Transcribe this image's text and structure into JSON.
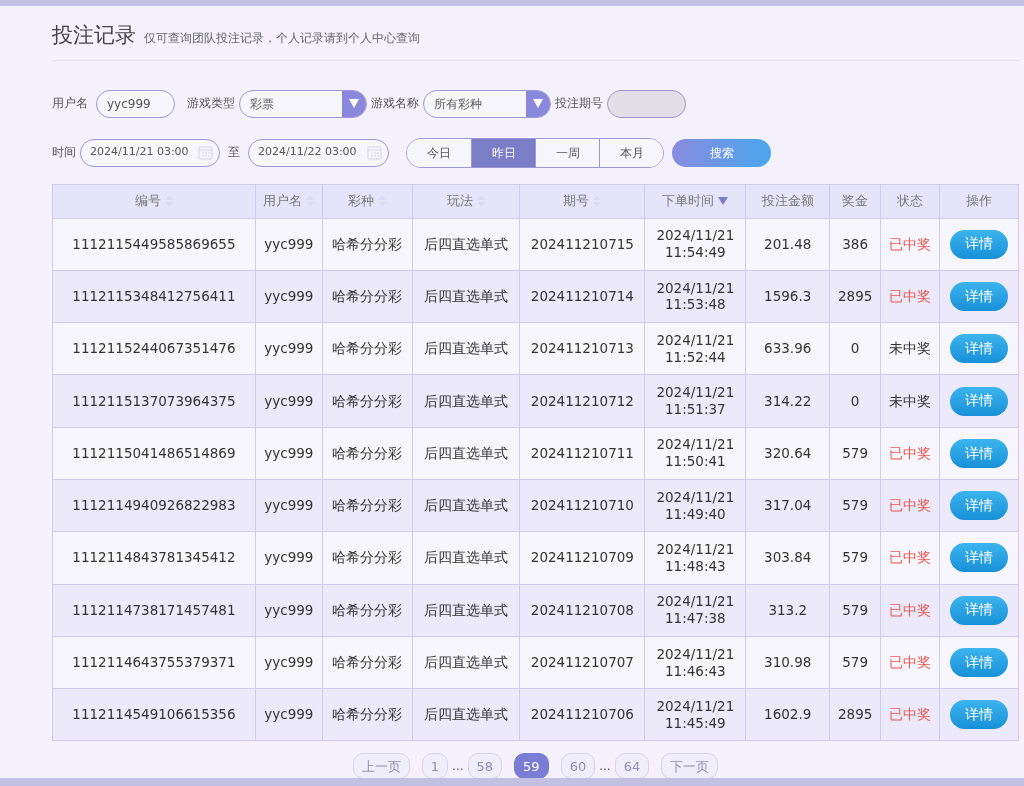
{
  "header": {
    "title": "投注记录",
    "subtitle": "仅可查询团队投注记录，个人记录请到个人中心查询"
  },
  "filters": {
    "username_label": "用户名",
    "username": "yyc999",
    "game_type_label": "游戏类型",
    "game_type": "彩票",
    "game_name_label": "游戏名称",
    "game_name": "所有彩种",
    "issue_label": "投注期号",
    "time_label": "时间",
    "time_from": "2024/11/21 03:00",
    "time_to_label": "至",
    "time_to": "2024/11/22 03:00",
    "ranges": [
      {
        "label": "今日",
        "selected": false
      },
      {
        "label": "昨日",
        "selected": true
      },
      {
        "label": "一周",
        "selected": false
      },
      {
        "label": "本月",
        "selected": false
      }
    ],
    "search_button": "搜索"
  },
  "table": {
    "columns": [
      {
        "label": "编号",
        "sortable": true,
        "sorted": false
      },
      {
        "label": "用户名",
        "sortable": true,
        "sorted": false
      },
      {
        "label": "彩种",
        "sortable": true,
        "sorted": false
      },
      {
        "label": "玩法",
        "sortable": true,
        "sorted": false
      },
      {
        "label": "期号",
        "sortable": true,
        "sorted": false
      },
      {
        "label": "下单时间",
        "sortable": true,
        "sorted": true
      },
      {
        "label": "投注金额",
        "sortable": false,
        "sorted": false
      },
      {
        "label": "奖金",
        "sortable": false,
        "sorted": false
      },
      {
        "label": "状态",
        "sortable": false,
        "sorted": false
      },
      {
        "label": "操作",
        "sortable": false,
        "sorted": false
      }
    ],
    "rows": [
      {
        "id": "1112115449585869655",
        "user": "yyc999",
        "lottery": "哈希分分彩",
        "play": "后四直选单式",
        "issue": "202411210715",
        "date": "2024/11/21",
        "time": "11:54:49",
        "amount": "201.48",
        "prize": "386",
        "status": "已中奖",
        "won": true,
        "action": "详情"
      },
      {
        "id": "1112115348412756411",
        "user": "yyc999",
        "lottery": "哈希分分彩",
        "play": "后四直选单式",
        "issue": "202411210714",
        "date": "2024/11/21",
        "time": "11:53:48",
        "amount": "1596.3",
        "prize": "2895",
        "status": "已中奖",
        "won": true,
        "action": "详情"
      },
      {
        "id": "1112115244067351476",
        "user": "yyc999",
        "lottery": "哈希分分彩",
        "play": "后四直选单式",
        "issue": "202411210713",
        "date": "2024/11/21",
        "time": "11:52:44",
        "amount": "633.96",
        "prize": "0",
        "status": "未中奖",
        "won": false,
        "action": "详情"
      },
      {
        "id": "1112115137073964375",
        "user": "yyc999",
        "lottery": "哈希分分彩",
        "play": "后四直选单式",
        "issue": "202411210712",
        "date": "2024/11/21",
        "time": "11:51:37",
        "amount": "314.22",
        "prize": "0",
        "status": "未中奖",
        "won": false,
        "action": "详情"
      },
      {
        "id": "1112115041486514869",
        "user": "yyc999",
        "lottery": "哈希分分彩",
        "play": "后四直选单式",
        "issue": "202411210711",
        "date": "2024/11/21",
        "time": "11:50:41",
        "amount": "320.64",
        "prize": "579",
        "status": "已中奖",
        "won": true,
        "action": "详情"
      },
      {
        "id": "1112114940926822983",
        "user": "yyc999",
        "lottery": "哈希分分彩",
        "play": "后四直选单式",
        "issue": "202411210710",
        "date": "2024/11/21",
        "time": "11:49:40",
        "amount": "317.04",
        "prize": "579",
        "status": "已中奖",
        "won": true,
        "action": "详情"
      },
      {
        "id": "1112114843781345412",
        "user": "yyc999",
        "lottery": "哈希分分彩",
        "play": "后四直选单式",
        "issue": "202411210709",
        "date": "2024/11/21",
        "time": "11:48:43",
        "amount": "303.84",
        "prize": "579",
        "status": "已中奖",
        "won": true,
        "action": "详情"
      },
      {
        "id": "1112114738171457481",
        "user": "yyc999",
        "lottery": "哈希分分彩",
        "play": "后四直选单式",
        "issue": "202411210708",
        "date": "2024/11/21",
        "time": "11:47:38",
        "amount": "313.2",
        "prize": "579",
        "status": "已中奖",
        "won": true,
        "action": "详情"
      },
      {
        "id": "1112114643755379371",
        "user": "yyc999",
        "lottery": "哈希分分彩",
        "play": "后四直选单式",
        "issue": "202411210707",
        "date": "2024/11/21",
        "time": "11:46:43",
        "amount": "310.98",
        "prize": "579",
        "status": "已中奖",
        "won": true,
        "action": "详情"
      },
      {
        "id": "1112114549106615356",
        "user": "yyc999",
        "lottery": "哈希分分彩",
        "play": "后四直选单式",
        "issue": "202411210706",
        "date": "2024/11/21",
        "time": "11:45:49",
        "amount": "1602.9",
        "prize": "2895",
        "status": "已中奖",
        "won": true,
        "action": "详情"
      }
    ]
  },
  "pagination": {
    "prev": "上一页",
    "next": "下一页",
    "items": [
      {
        "kind": "page",
        "label": "1",
        "selected": false
      },
      {
        "kind": "ellipsis",
        "label": "..."
      },
      {
        "kind": "page",
        "label": "58",
        "selected": false
      },
      {
        "kind": "page",
        "label": "59",
        "selected": true
      },
      {
        "kind": "page",
        "label": "60",
        "selected": false
      },
      {
        "kind": "ellipsis",
        "label": "..."
      },
      {
        "kind": "page",
        "label": "64",
        "selected": false
      }
    ]
  }
}
